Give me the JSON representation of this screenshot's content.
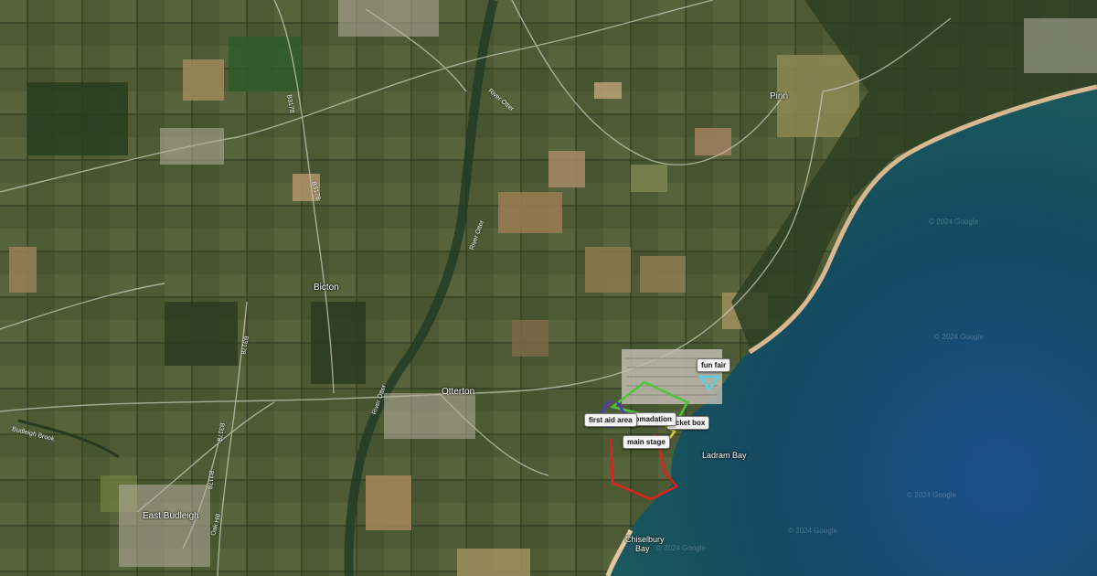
{
  "places": {
    "pinn": "Pinn",
    "bicton": "Bicton",
    "otterton": "Otterton",
    "east_budleigh": "East Budleigh",
    "ladram_bay": "Ladram Bay",
    "chiselbury_bay_1": "Chiselbury",
    "chiselbury_bay_2": "Bay",
    "budleigh_brook": "Budleigh Brook"
  },
  "roads": {
    "b3178_a": "B3178",
    "b3178_b": "B3178",
    "b3178_c": "B3178",
    "b3178_d": "B3178",
    "b3178_e": "B3178",
    "river_otter_a": "River Otter",
    "river_otter_b": "River Otter",
    "river_otter_c": "River Otter",
    "oak_hill": "Oak Hill"
  },
  "watermarks": {
    "w1": "© 2024 Google",
    "w2": "© 2024 Google",
    "w3": "© 2024 Google",
    "w4": "© 2024 Google",
    "w5": "© 2024 Google"
  },
  "markers": {
    "fun_fair": "fun fair",
    "first_aid": "first aid area",
    "accommodation": "comadation",
    "ticket_box": "ticket box",
    "main_stage": "main stage"
  },
  "colors": {
    "main_stage": "#e0201c",
    "accommodation": "#4fc43a",
    "first_aid": "#4a3ac8",
    "fun_fair": "#5ad0e8",
    "ticket_box": "#d8d040",
    "sea": "#0f4a5a"
  }
}
